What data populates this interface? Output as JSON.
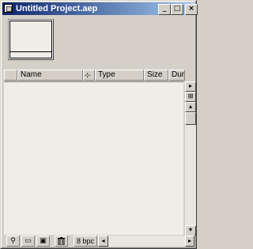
{
  "window": {
    "title": "Untitled Project.aep",
    "controls": {
      "minimize_glyph": "_",
      "maximize_glyph": "□",
      "close_glyph": "×"
    }
  },
  "columns": [
    {
      "label": "",
      "icon": "label-color-icon"
    },
    {
      "label": "Name"
    },
    {
      "label": "",
      "icon": "flowchart-icon"
    },
    {
      "label": "Type"
    },
    {
      "label": "Size"
    },
    {
      "label": "Durat"
    }
  ],
  "scrollbar": {
    "menu_glyph": "▸",
    "flow_glyph": "⊞",
    "up_glyph": "▴",
    "down_glyph": "▾",
    "left_glyph": "◂",
    "right_glyph": "▸"
  },
  "toolbar": {
    "find_glyph": "⚲",
    "folder_glyph": "▭",
    "comp_glyph": "▣",
    "trash_glyph": "🗑",
    "bpc_label": "8 bpc"
  },
  "icons": [
    "app-icon",
    "minimize-icon",
    "maximize-icon",
    "close-icon",
    "find-icon",
    "new-folder-icon",
    "new-composition-icon",
    "trash-icon",
    "panel-menu-icon",
    "flowchart-icon",
    "scroll-up-icon",
    "scroll-down-icon",
    "scroll-left-icon",
    "scroll-right-icon"
  ],
  "colors": {
    "titlebar_start": "#0a246a",
    "titlebar_end": "#a6caf0",
    "panel": "#d4d0c8",
    "list_bg": "#f0ece8"
  }
}
